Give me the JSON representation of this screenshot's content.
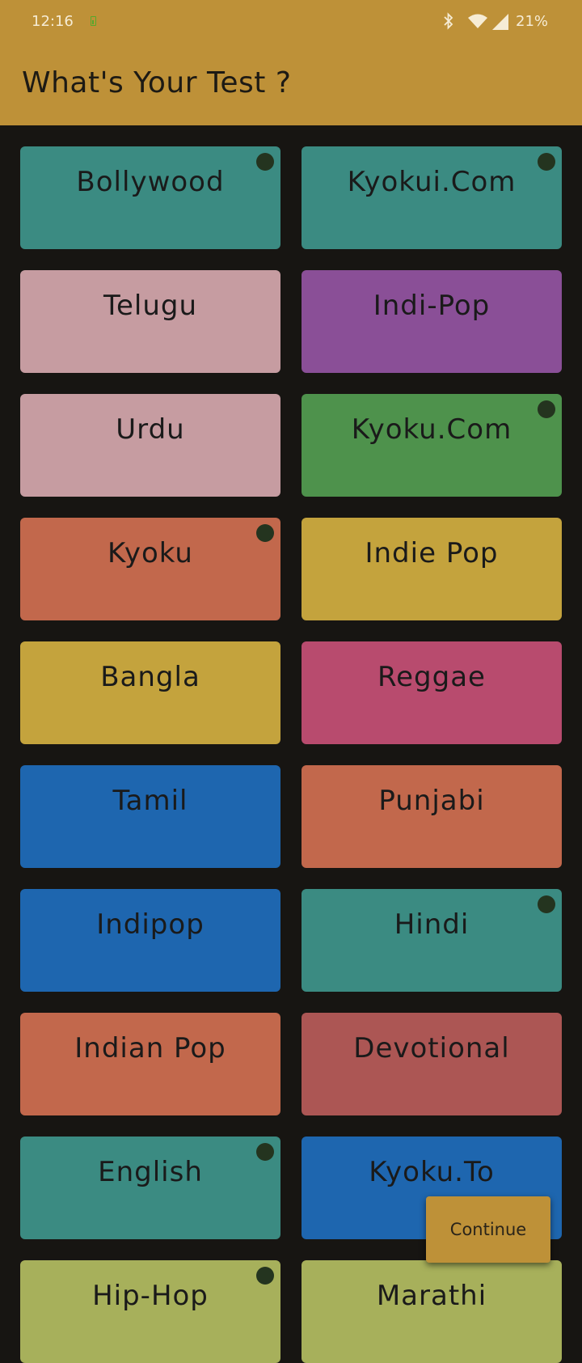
{
  "status_bar": {
    "time": "12:16",
    "battery_percent": "21%",
    "icons": [
      "battery-saver-icon",
      "bluetooth-icon",
      "wifi-icon",
      "cellular-signal-icon"
    ]
  },
  "app_bar": {
    "title": "What's Your Test ?"
  },
  "colors": {
    "accent": "#be9138",
    "background": "#171512",
    "selected_dot": "#24341f"
  },
  "genres": [
    {
      "label": "Bollywood",
      "color": "#3b8b82",
      "selected": true
    },
    {
      "label": "Kyokui.Com",
      "color": "#3b8b82",
      "selected": true
    },
    {
      "label": "Telugu",
      "color": "#c69ca1",
      "selected": false
    },
    {
      "label": "Indi-Pop",
      "color": "#8a4f97",
      "selected": false
    },
    {
      "label": "Urdu",
      "color": "#c69ca1",
      "selected": false
    },
    {
      "label": "Kyoku.Com",
      "color": "#4e924c",
      "selected": true
    },
    {
      "label": "Kyoku",
      "color": "#c2684c",
      "selected": true
    },
    {
      "label": "Indie Pop",
      "color": "#c4a33d",
      "selected": false
    },
    {
      "label": "Bangla",
      "color": "#c4a33d",
      "selected": false
    },
    {
      "label": "Reggae",
      "color": "#b84b6e",
      "selected": false
    },
    {
      "label": "Tamil",
      "color": "#1e66af",
      "selected": false
    },
    {
      "label": "Punjabi",
      "color": "#c2684c",
      "selected": false
    },
    {
      "label": "Indipop",
      "color": "#1e66af",
      "selected": false
    },
    {
      "label": "Hindi",
      "color": "#3b8b82",
      "selected": true
    },
    {
      "label": "Indian Pop",
      "color": "#c2684c",
      "selected": false
    },
    {
      "label": "Devotional",
      "color": "#ac5654",
      "selected": false
    },
    {
      "label": "English",
      "color": "#3b8b82",
      "selected": true
    },
    {
      "label": "Kyoku.To",
      "color": "#1e66af",
      "selected": false
    },
    {
      "label": "Hip-Hop",
      "color": "#a7b05b",
      "selected": true
    },
    {
      "label": "Marathi",
      "color": "#a7b05b",
      "selected": false
    }
  ],
  "continue_button": {
    "label": "Continue"
  }
}
